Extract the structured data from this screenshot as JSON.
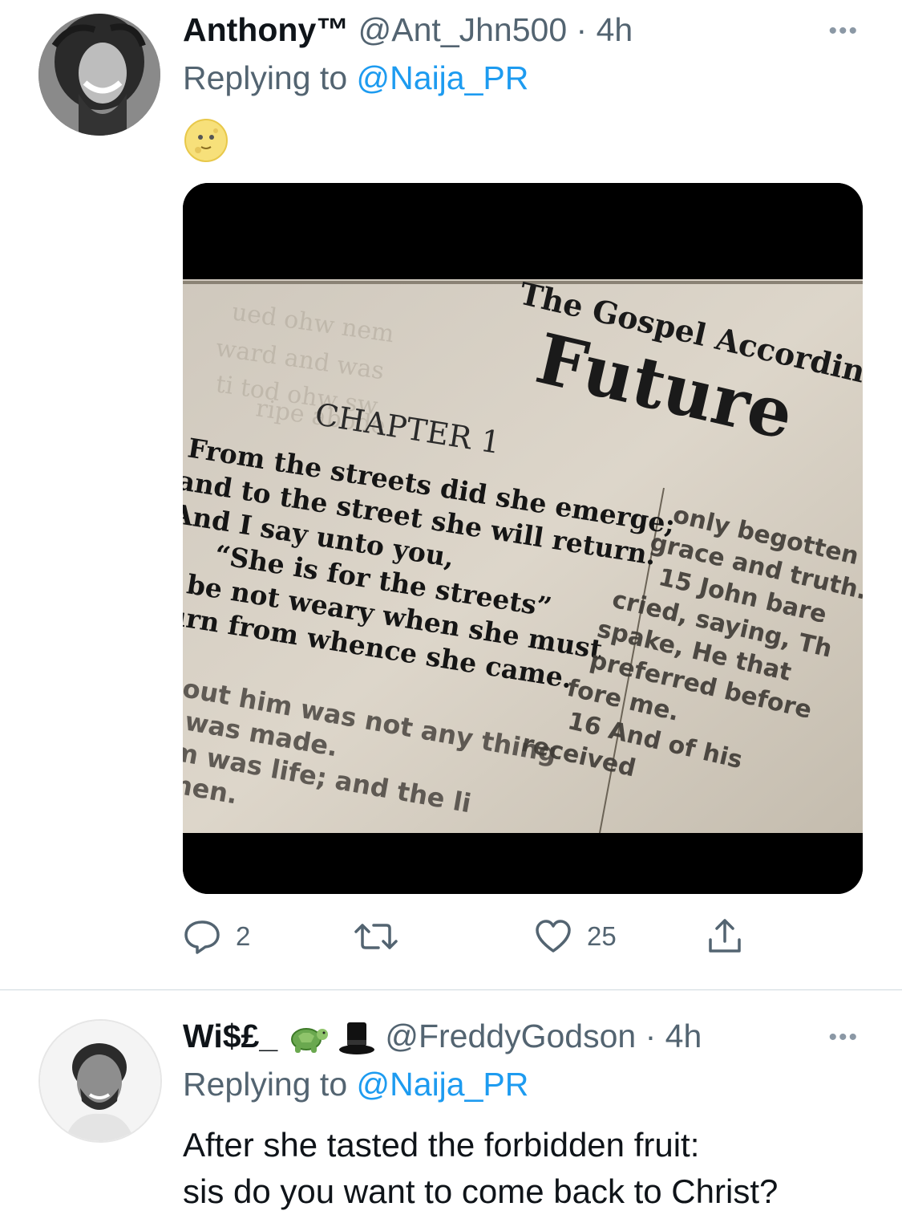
{
  "tweets": [
    {
      "name": "Anthony™",
      "handle": "@Ant_Jhn500",
      "sep": "·",
      "time": "4h",
      "replying_prefix": "Replying to",
      "replying_to": "@Naija_PR",
      "body_emoji": "moon-face-emoji",
      "media": {
        "header": "The Gospel According t",
        "title": "Future",
        "chapter": "CHAPTER 1",
        "verse_lines": [
          "From the streets did she emerge;",
          "and to the street she will return.",
          "And I say unto you,",
          "“She is for the streets”",
          "o be not weary when she must",
          "turn from whence she came."
        ],
        "lower_lines": [
          "out him was not any thing",
          "was made.",
          "m was life; and the li",
          "men."
        ],
        "right_column": [
          "only begotten",
          "grace and truth.",
          "15 John bare",
          "cried, saying, Th",
          "spake, He that",
          "preferred before",
          "fore me.",
          "16 And of his",
          "received"
        ]
      },
      "actions": {
        "replies": "2",
        "retweets": "",
        "likes": "25"
      }
    },
    {
      "name": "Wi$£_",
      "name_emojis": [
        "turtle-emoji",
        "top-hat-emoji"
      ],
      "handle": "@FreddyGodson",
      "sep": "·",
      "time": "4h",
      "replying_prefix": "Replying to",
      "replying_to": "@Naija_PR",
      "body_lines": [
        "After she tasted the forbidden fruit:",
        "sis do you want to come back to Christ?"
      ]
    }
  ],
  "more_label": "•••",
  "colors": {
    "link": "#1d9bf0",
    "muted": "#536471",
    "divider": "#cfd9de"
  }
}
